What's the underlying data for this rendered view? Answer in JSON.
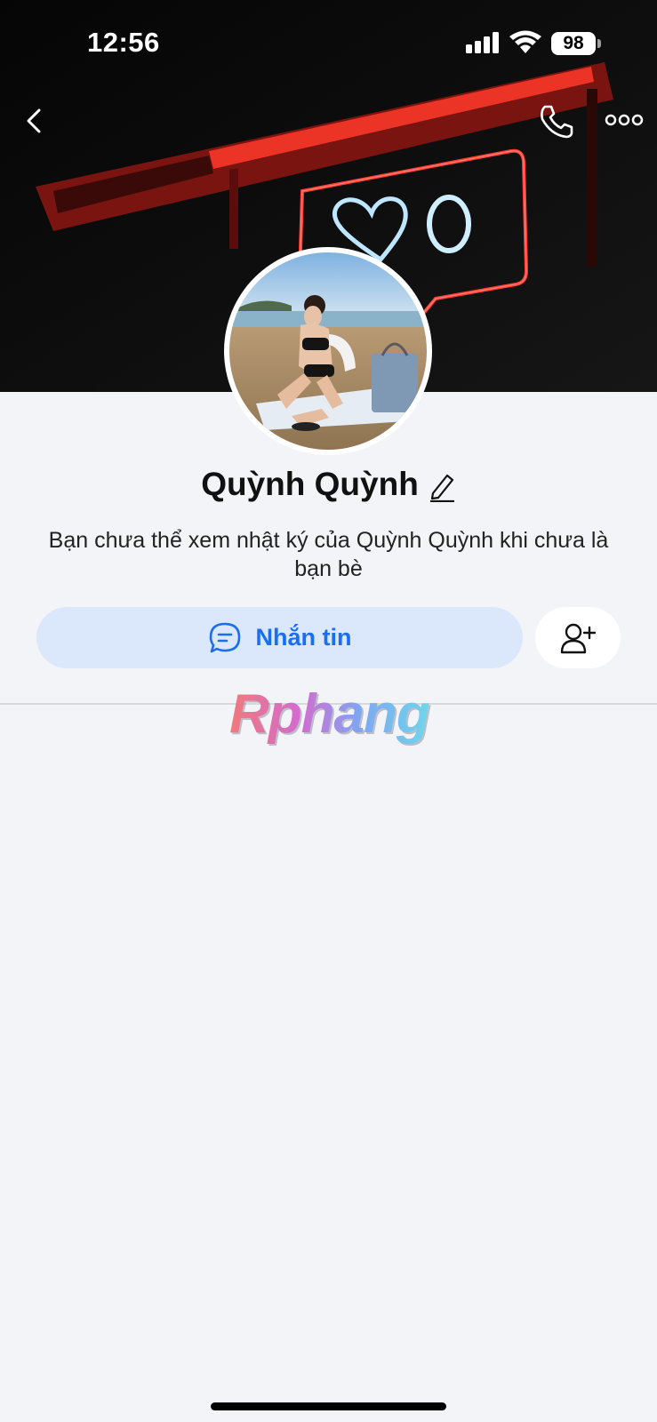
{
  "status_bar": {
    "time": "12:56",
    "battery": "98"
  },
  "header": {
    "back_icon": "chevron-left-icon",
    "call_icon": "phone-icon",
    "more_icon": "more-dots-icon"
  },
  "profile": {
    "name": "Quỳnh Quỳnh",
    "edit_icon": "pencil-icon",
    "notice": "Bạn chưa thể xem nhật ký của Quỳnh Quỳnh khi chưa là bạn bè"
  },
  "actions": {
    "message_label": "Nhắn tin",
    "message_icon": "chat-bubble-icon",
    "add_friend_icon": "add-friend-icon"
  },
  "watermark": "Rphang",
  "colors": {
    "accent": "#1a6ef0",
    "button_bg": "#dbe7fb",
    "page_bg": "#f3f4f7"
  }
}
